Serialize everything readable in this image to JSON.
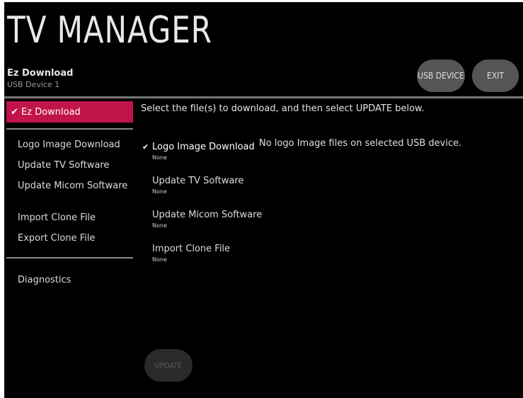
{
  "header": {
    "title": "TV MANAGER",
    "section": "Ez Download",
    "device": "USB Device 1",
    "usb_button": "USB DEVICE",
    "exit_button": "EXIT"
  },
  "sidebar": {
    "active": "✔ Ez Download",
    "items": [
      "Logo Image Download",
      "Update TV Software",
      "Update Micom Software",
      "Import Clone File",
      "Export Clone File",
      "Diagnostics"
    ]
  },
  "main": {
    "instruction": "Select the file(s) to download, and then select UPDATE below.",
    "files": [
      {
        "title": "Logo Image Download",
        "status": "None",
        "checked": true
      },
      {
        "title": "Update TV Software",
        "status": "None",
        "checked": false
      },
      {
        "title": "Update Micom Software",
        "status": "None",
        "checked": false
      },
      {
        "title": "Import Clone File",
        "status": "None",
        "checked": false
      }
    ],
    "message": "No logo Image files on selected USB device.",
    "update_button": "UPDATE"
  },
  "colors": {
    "accent": "#c0144b",
    "background": "#000000",
    "button": "#555555"
  }
}
